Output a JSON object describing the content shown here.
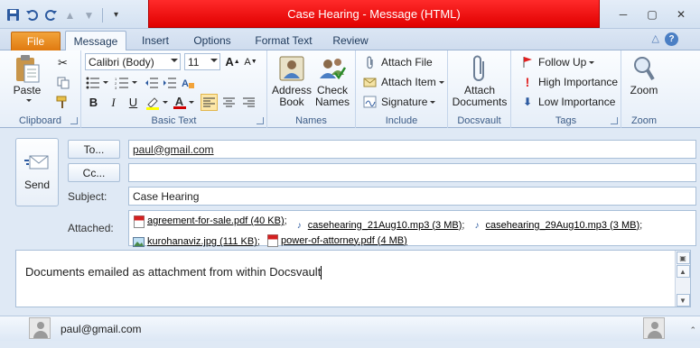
{
  "window": {
    "title": "Case Hearing  -  Message (HTML)",
    "controls": {
      "minimize": "─",
      "maximize": "▢",
      "close": "✕"
    }
  },
  "quick_access": [
    {
      "name": "save-icon",
      "glyph": "💾"
    },
    {
      "name": "undo-icon",
      "glyph": "↶"
    },
    {
      "name": "redo-icon",
      "glyph": "↻"
    },
    {
      "name": "up-icon",
      "glyph": "⇧"
    },
    {
      "name": "down-icon",
      "glyph": "⇩"
    },
    {
      "name": "customize-icon",
      "glyph": "▾"
    }
  ],
  "tabs": {
    "file": "File",
    "items": [
      "Message",
      "Insert",
      "Options",
      "Format Text",
      "Review"
    ],
    "active": "Message"
  },
  "ribbon": {
    "clipboard": {
      "label": "Clipboard",
      "paste": "Paste"
    },
    "basic_text": {
      "label": "Basic Text",
      "font": "Calibri (Body)",
      "size": "11",
      "grow_font": "A",
      "shrink_font": "A",
      "bold": "B",
      "italic": "I",
      "underline": "U",
      "font_color": "A"
    },
    "names": {
      "label": "Names",
      "address_book_line1": "Address",
      "address_book_line2": "Book",
      "check_names_line1": "Check",
      "check_names_line2": "Names"
    },
    "include": {
      "label": "Include",
      "attach_file": "Attach File",
      "attach_item": "Attach Item",
      "signature": "Signature"
    },
    "docsvault": {
      "label": "Docsvault",
      "attach_docs_line1": "Attach",
      "attach_docs_line2": "Documents"
    },
    "tags": {
      "label": "Tags",
      "follow_up": "Follow Up",
      "high_importance": "High Importance",
      "low_importance": "Low Importance"
    },
    "zoom": {
      "label": "Zoom",
      "zoom": "Zoom"
    }
  },
  "compose": {
    "send": "Send",
    "to_button": "To...",
    "cc_button": "Cc...",
    "to_value": "paul@gmail.com",
    "cc_value": "",
    "subject_label": "Subject:",
    "subject_value": "Case Hearing",
    "attached_label": "Attached:",
    "attachments": [
      {
        "type": "pdf",
        "name": "agreement-for-sale.pdf (40 KB)",
        "sep": ";"
      },
      {
        "type": "audio",
        "name": "casehearing_21Aug10.mp3 (3 MB)",
        "sep": ";"
      },
      {
        "type": "audio",
        "name": "casehearing_29Aug10.mp3 (3 MB)",
        "sep": ";"
      },
      {
        "type": "image",
        "name": "kurohanaviz.jpg (111 KB)",
        "sep": ";"
      },
      {
        "type": "pdf",
        "name": "power-of-attorney.pdf (4 MB)",
        "sep": ""
      }
    ],
    "body": "Documents emailed as attachment from within Docsvault"
  },
  "people_pane": {
    "name": "paul@gmail.com"
  },
  "colors": {
    "title_red": "#e00000",
    "file_tab": "#e07a10",
    "accent": "#2c5aa0"
  }
}
